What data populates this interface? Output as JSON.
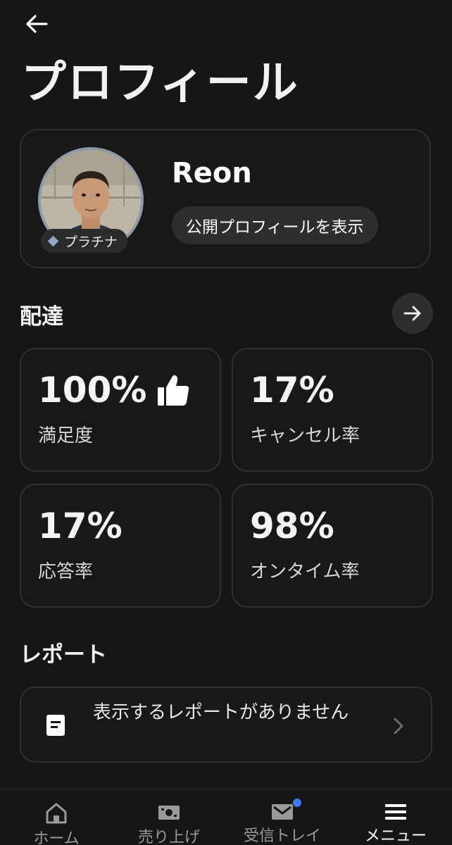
{
  "header": {
    "back_icon": "arrow-left-icon",
    "title": "プロフィール"
  },
  "profile": {
    "name": "Reon",
    "tier": "プラチナ",
    "tier_icon": "diamond-icon",
    "public_profile_button": "公開プロフィールを表示"
  },
  "delivery": {
    "title": "配達",
    "arrow_icon": "arrow-right-icon",
    "stats": [
      {
        "value": "100%",
        "label": "満足度",
        "icon": "thumbs-up-icon"
      },
      {
        "value": "17%",
        "label": "キャンセル率"
      },
      {
        "value": "17%",
        "label": "応答率"
      },
      {
        "value": "98%",
        "label": "オンタイム率"
      }
    ]
  },
  "reports": {
    "title": "レポート",
    "empty_text": "表示するレポートがありません",
    "chevron_icon": "chevron-right-icon"
  },
  "bottom_nav": {
    "items": [
      {
        "label": "ホーム",
        "icon": "home-icon"
      },
      {
        "label": "売り上げ",
        "icon": "earnings-icon"
      },
      {
        "label": "受信トレイ",
        "icon": "mail-icon"
      },
      {
        "label": "メニュー",
        "icon": "menu-icon"
      }
    ],
    "active": "メニュー"
  },
  "colors": {
    "background": "#161616",
    "card_border": "#303030",
    "pill": "#2e2e2e",
    "notification": "#3f7ce8",
    "tier_diamond": "#8fa9c4"
  }
}
